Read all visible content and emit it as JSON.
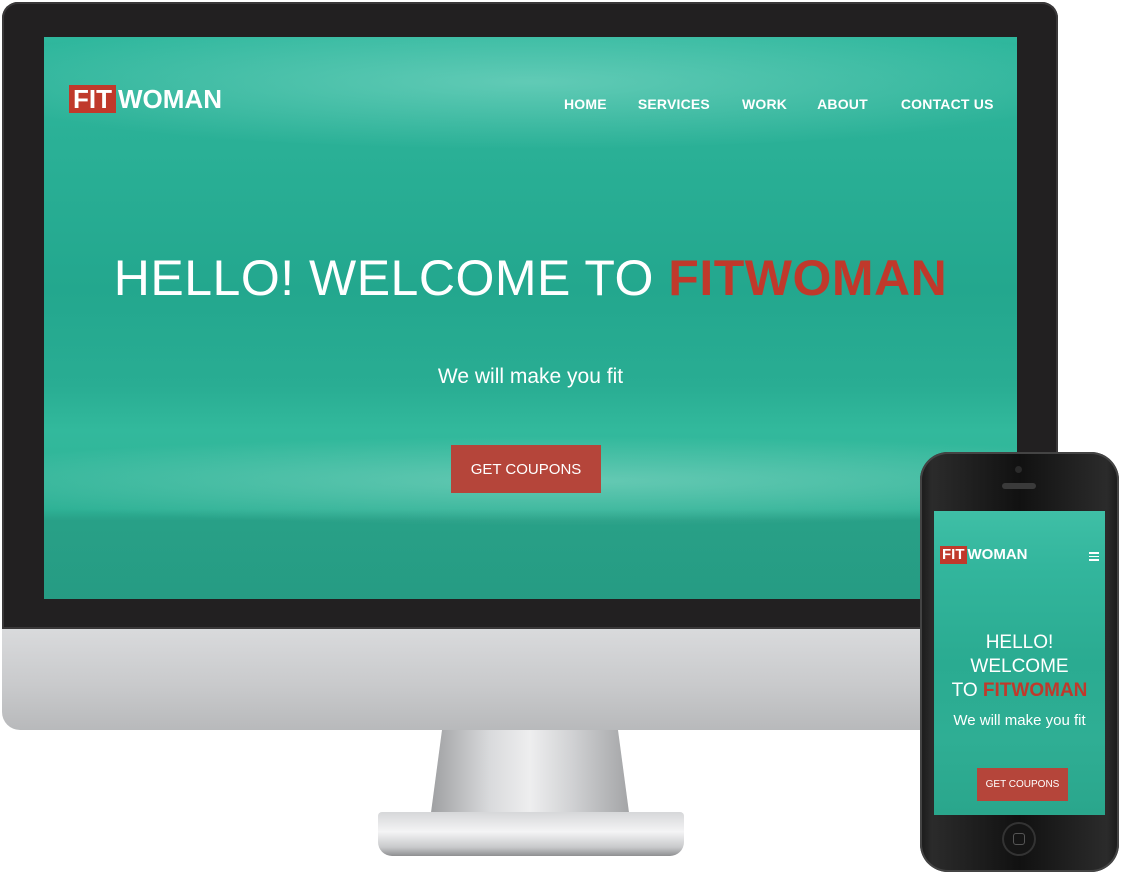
{
  "desktop": {
    "logo": {
      "fit": "FIT",
      "woman": "WOMAN"
    },
    "nav": [
      {
        "label": "HOME"
      },
      {
        "label": "SERVICES"
      },
      {
        "label": "WORK"
      },
      {
        "label": "ABOUT"
      },
      {
        "label": "CONTACT US"
      }
    ],
    "hero": {
      "title_prefix": "HELLO! WELCOME TO ",
      "title_brand": "FITWOMAN",
      "subtitle": "We will make you fit",
      "cta_label": "GET COUPONS"
    }
  },
  "mobile": {
    "logo": {
      "fit": "FIT",
      "woman": "WOMAN"
    },
    "hero": {
      "title_line1": "HELLO! WELCOME",
      "title_line2_prefix": "TO ",
      "title_brand": "FITWOMAN",
      "subtitle": "We will make you fit",
      "cta_label": "GET COUPONS"
    },
    "menu_icon": "hamburger-icon"
  },
  "colors": {
    "accent": "#c0392b",
    "overlay_teal": "#2ab096",
    "text": "#ffffff"
  }
}
